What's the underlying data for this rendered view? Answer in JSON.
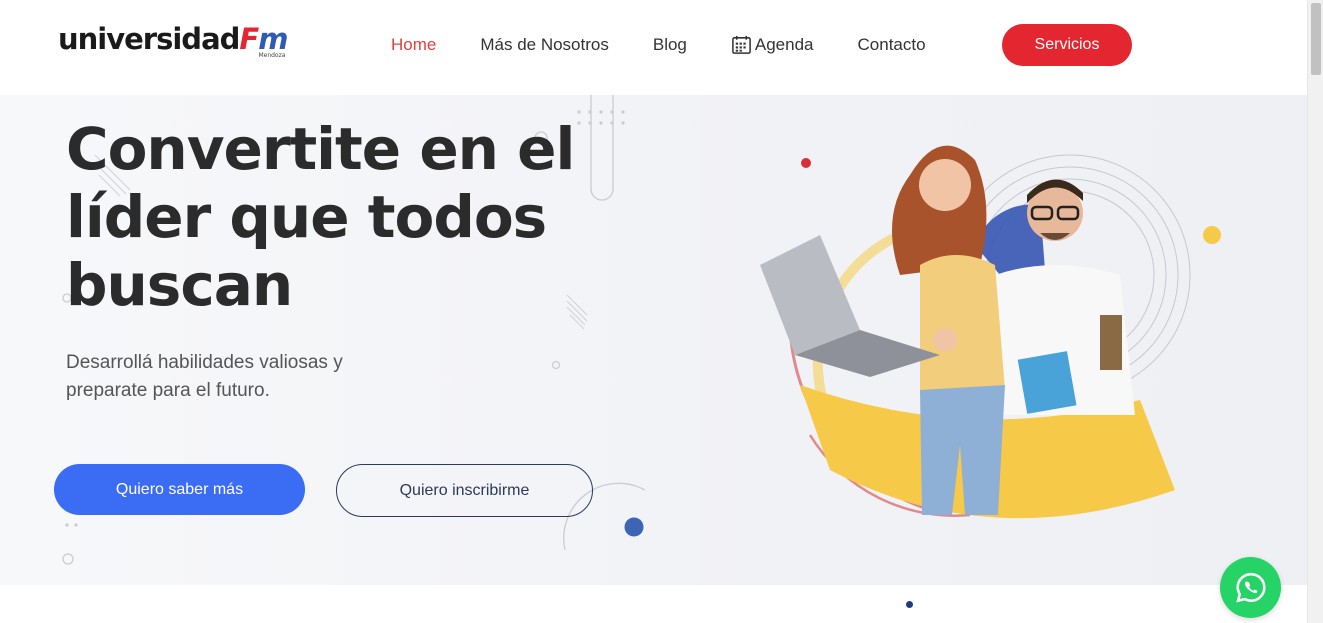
{
  "header": {
    "logo": {
      "text_main": "universidad",
      "text_f": "F",
      "text_m": "m",
      "text_sub": "Mendoza"
    },
    "nav": [
      {
        "label": "Home",
        "active": true
      },
      {
        "label": "Más de Nosotros"
      },
      {
        "label": "Blog"
      },
      {
        "label": "Agenda",
        "icon": "calendar-icon"
      },
      {
        "label": "Contacto"
      }
    ],
    "cta_label": "Servicios"
  },
  "hero": {
    "title": "Convertite en el líder que todos buscan",
    "subtitle": "Desarrollá habilidades valiosas y preparate para el futuro.",
    "primary_button": "Quiero saber más",
    "secondary_button": "Quiero inscribirme"
  },
  "floating": {
    "whatsapp_icon": "whatsapp-icon"
  },
  "colors": {
    "accent_red": "#e3262f",
    "accent_blue": "#3a6cf4",
    "dark_navy": "#2b3a57",
    "whatsapp_green": "#25d366",
    "yellow": "#f7c948"
  }
}
